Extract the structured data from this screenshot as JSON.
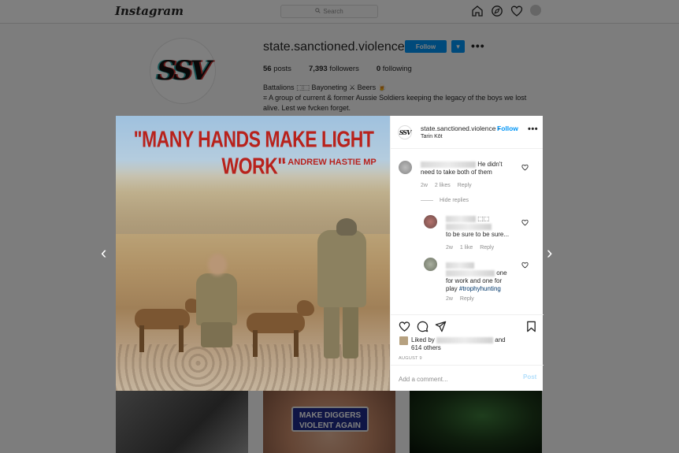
{
  "app": {
    "logo": "Instagram",
    "search_placeholder": "Search",
    "icons": [
      "home-icon",
      "explore-icon",
      "heart-icon",
      "profile-avatar"
    ]
  },
  "profile": {
    "username": "state.sanctioned.violence",
    "avatar_text": "SSV",
    "follow_label": "Follow",
    "more_label": "▾",
    "options_label": "•••",
    "stats": {
      "posts": "56",
      "posts_label": "posts",
      "followers": "7,393",
      "followers_label": "followers",
      "following": "0",
      "following_label": "following"
    },
    "bio": {
      "line1": "Battalions ⬚⬚ Bayoneting ⚔ Beers 🍺",
      "line2": "⌗ A group of current & former Aussie Soldiers keeping the legacy of the boys we lost",
      "line3": "alive. Lest we fvcken forget."
    }
  },
  "grid": {
    "tile2_text": "MAKE DIGGERS VIOLENT AGAIN"
  },
  "post": {
    "image": {
      "quote": "\"MANY HANDS MAKE LIGHT WORK\"",
      "author": "- ANDREW HASTIE MP"
    },
    "header": {
      "avatar_text": "SSV",
      "username": "state.sanctioned.violence",
      "separator": "•",
      "follow_label": "Follow",
      "location": "Tarin Kōt",
      "more_label": "•••"
    },
    "comments": [
      {
        "text": "He didn't need to take both of them",
        "time": "2w",
        "likes": "2 likes",
        "reply_label": "Reply"
      }
    ],
    "hide_replies_label": "Hide replies",
    "replies": [
      {
        "text": "to be sure to be sure...",
        "suffix": "⬚⬚",
        "time": "2w",
        "likes": "1 like",
        "reply_label": "Reply"
      },
      {
        "text_a": "one",
        "text_b": "for work and one for",
        "text_c": "play ",
        "hashtag": "#trophyhunting",
        "time": "2w",
        "reply_label": "Reply"
      }
    ],
    "liked_by_prefix": "Liked by",
    "liked_by_and": "and",
    "liked_by_others": "614 others",
    "date": "AUGUST 9",
    "add_comment_placeholder": "Add a comment...",
    "post_label": "Post"
  },
  "nav": {
    "prev": "‹",
    "next": "›"
  },
  "colors": {
    "accent": "#0095f6",
    "quote": "#b8221c",
    "hashtag": "#00376b"
  }
}
